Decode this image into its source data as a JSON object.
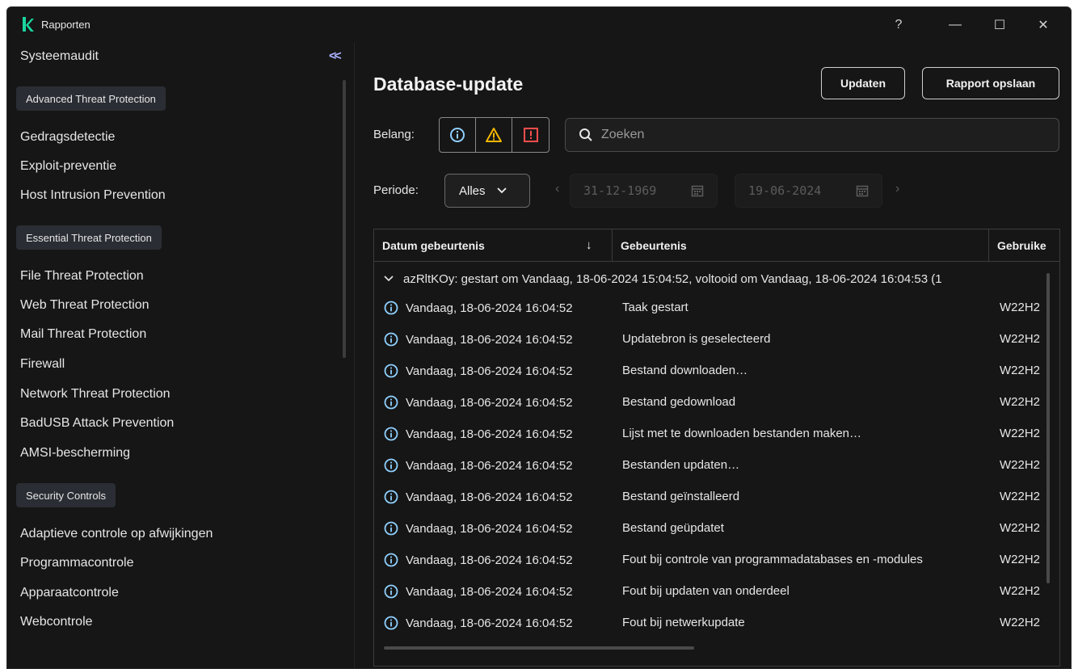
{
  "window": {
    "title": "Rapporten",
    "help_label": "?",
    "minimize_label": "—",
    "maximize_label": "☐",
    "close_label": "✕"
  },
  "sidebar": {
    "collapse_label": "<<",
    "items": [
      {
        "type": "item",
        "label": "Systeemaudit"
      },
      {
        "type": "group",
        "label": "Advanced Threat Protection"
      },
      {
        "type": "item",
        "label": "Gedragsdetectie"
      },
      {
        "type": "item",
        "label": "Exploit-preventie"
      },
      {
        "type": "item",
        "label": "Host Intrusion Prevention"
      },
      {
        "type": "group",
        "label": "Essential Threat Protection"
      },
      {
        "type": "item",
        "label": "File Threat Protection"
      },
      {
        "type": "item",
        "label": "Web Threat Protection"
      },
      {
        "type": "item",
        "label": "Mail Threat Protection"
      },
      {
        "type": "item",
        "label": "Firewall"
      },
      {
        "type": "item",
        "label": "Network Threat Protection"
      },
      {
        "type": "item",
        "label": "BadUSB Attack Prevention"
      },
      {
        "type": "item",
        "label": "AMSI-bescherming"
      },
      {
        "type": "group",
        "label": "Security Controls"
      },
      {
        "type": "item",
        "label": "Adaptieve controle op afwijkingen"
      },
      {
        "type": "item",
        "label": "Programmacontrole"
      },
      {
        "type": "item",
        "label": "Apparaatcontrole"
      },
      {
        "type": "item",
        "label": "Webcontrole"
      }
    ]
  },
  "main": {
    "title": "Database-update",
    "update_button": "Updaten",
    "save_report_button": "Rapport opslaan",
    "severity_label": "Belang:",
    "search_placeholder": "Zoeken",
    "period_label": "Periode:",
    "period_value": "Alles",
    "date_from": "31-12-1969",
    "date_to": "19-06-2024"
  },
  "colors": {
    "info": "#8fd0ff",
    "warning": "#f5b800",
    "critical": "#ff4d4d",
    "accent": "#aab0ff"
  },
  "table": {
    "columns": [
      "Datum gebeurtenis",
      "Gebeurtenis",
      "Gebruike"
    ],
    "sort_icon": "↓",
    "group_label": "azRltKOy: gestart om Vandaag, 18-06-2024 15:04:52, voltooid om Vandaag, 18-06-2024 16:04:53 (1",
    "rows": [
      {
        "date": "Vandaag, 18-06-2024 16:04:52",
        "event": "Taak gestart",
        "user": "W22H2"
      },
      {
        "date": "Vandaag, 18-06-2024 16:04:52",
        "event": "Updatebron is geselecteerd",
        "user": "W22H2"
      },
      {
        "date": "Vandaag, 18-06-2024 16:04:52",
        "event": "Bestand downloaden…",
        "user": "W22H2"
      },
      {
        "date": "Vandaag, 18-06-2024 16:04:52",
        "event": "Bestand gedownload",
        "user": "W22H2"
      },
      {
        "date": "Vandaag, 18-06-2024 16:04:52",
        "event": "Lijst met te downloaden bestanden maken…",
        "user": "W22H2"
      },
      {
        "date": "Vandaag, 18-06-2024 16:04:52",
        "event": "Bestanden updaten…",
        "user": "W22H2"
      },
      {
        "date": "Vandaag, 18-06-2024 16:04:52",
        "event": "Bestand geïnstalleerd",
        "user": "W22H2"
      },
      {
        "date": "Vandaag, 18-06-2024 16:04:52",
        "event": "Bestand geüpdatet",
        "user": "W22H2"
      },
      {
        "date": "Vandaag, 18-06-2024 16:04:52",
        "event": "Fout bij controle van programmadatabases en -modules",
        "user": "W22H2"
      },
      {
        "date": "Vandaag, 18-06-2024 16:04:52",
        "event": "Fout bij updaten van onderdeel",
        "user": "W22H2"
      },
      {
        "date": "Vandaag, 18-06-2024 16:04:52",
        "event": "Fout bij netwerkupdate",
        "user": "W22H2"
      }
    ]
  }
}
